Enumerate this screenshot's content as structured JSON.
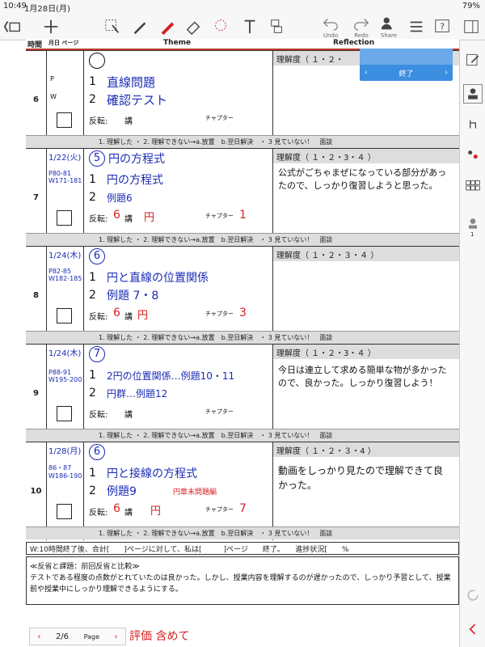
{
  "status": {
    "time": "10:49",
    "date": "1月28日(月)",
    "battery": "79%"
  },
  "toolbar": {
    "undo": "Undo",
    "redo": "Redo",
    "share": "Share"
  },
  "popup": {
    "title": "",
    "done": "終了"
  },
  "header": {
    "col_time": "時間",
    "col_date": "月日 ページ",
    "col_theme": "Theme",
    "col_reflection": "Reflection"
  },
  "rows": [
    {
      "num": "6",
      "date": "",
      "pages": "",
      "theme_no": "",
      "line1": "直線問題",
      "line2": "確認テスト",
      "hanten": "反転:",
      "ko": "講",
      "chapter": "チャプター",
      "ref_label": "理解度（ １・２・",
      "ref_text": ""
    },
    {
      "num": "7",
      "date": "1/22(火)",
      "pages": "P80-81 W171-181",
      "theme_no": "5",
      "line1": "円の方程式",
      "line2": "例題6",
      "hanten": "反転:",
      "hanten_val": "6",
      "ko": "講",
      "ko_val": "円",
      "chapter": "チャプター",
      "chapter_val": "1",
      "ref_label": "理解度（ １・２・3・４ ）",
      "ref_text": "公式がごちゃまぜになっている部分があったので、しっかり復習しようと思った。"
    },
    {
      "num": "8",
      "date": "1/24(木)",
      "pages": "P82-85 W182-185",
      "theme_no": "6",
      "line1": "円と直線の位置関係",
      "line2": "例題 7・8",
      "hanten": "反転:",
      "hanten_val": "6",
      "ko": "講",
      "ko_val": "円",
      "chapter": "チャプター",
      "chapter_val": "3",
      "ref_label": "理解度（ １・２・３・４ ）",
      "ref_text": ""
    },
    {
      "num": "9",
      "date": "1/24(木)",
      "pages": "P88-91 W195-200",
      "theme_no": "7",
      "line1": "2円の位置関係…例題10・11",
      "line2": "円群…例題12",
      "hanten": "反転:",
      "ko": "講",
      "chapter": "チャプター",
      "ref_label": "理解度（ １・２・3・４ ）",
      "ref_text": "今日は連立して求める簡単な物が多かったので、良かった。しっかり復習しよう！"
    },
    {
      "num": "10",
      "date": "1/28(月)",
      "pages": "86・87 W186-190",
      "theme_no": "6",
      "line1": "円と接線の方程式",
      "line2": "例題9",
      "line2_note": "円章末問題編",
      "hanten": "反転:",
      "hanten_val": "6",
      "ko": "講",
      "ko_val": "円",
      "chapter": "チャプター",
      "chapter_val": "7",
      "ref_label": "理解度（ １・２・３・4 ）",
      "ref_text": "動画をしっかり見たので理解できて良かった。"
    }
  ],
  "strip": "1. 理解した ・ 2. 理解できない→a.放置　b.翌日解決　・ 3 見ていない！　面談",
  "footer1": "W:10時間終了後、合計[　　]ページに対して、私は[　　　]ページ　　終了。　　進捗状況[　　%",
  "footer2_label": "≪反省と課題：前回反省と比較≫",
  "footer2_text": "テストである程度の点数がとれていたのは良かった。しかし、授業内容を理解するのが遅かったので、しっかり予習として、授業前や授業中にしっかり理解できるようにする。",
  "pager": {
    "page": "2/6",
    "label": "Page",
    "note": "評価 含めて"
  },
  "sidebar_count": "1",
  "colors": {
    "ink_blue": "#1a2bb5",
    "ink_red": "#d62020",
    "accent": "#3c8ee0"
  }
}
